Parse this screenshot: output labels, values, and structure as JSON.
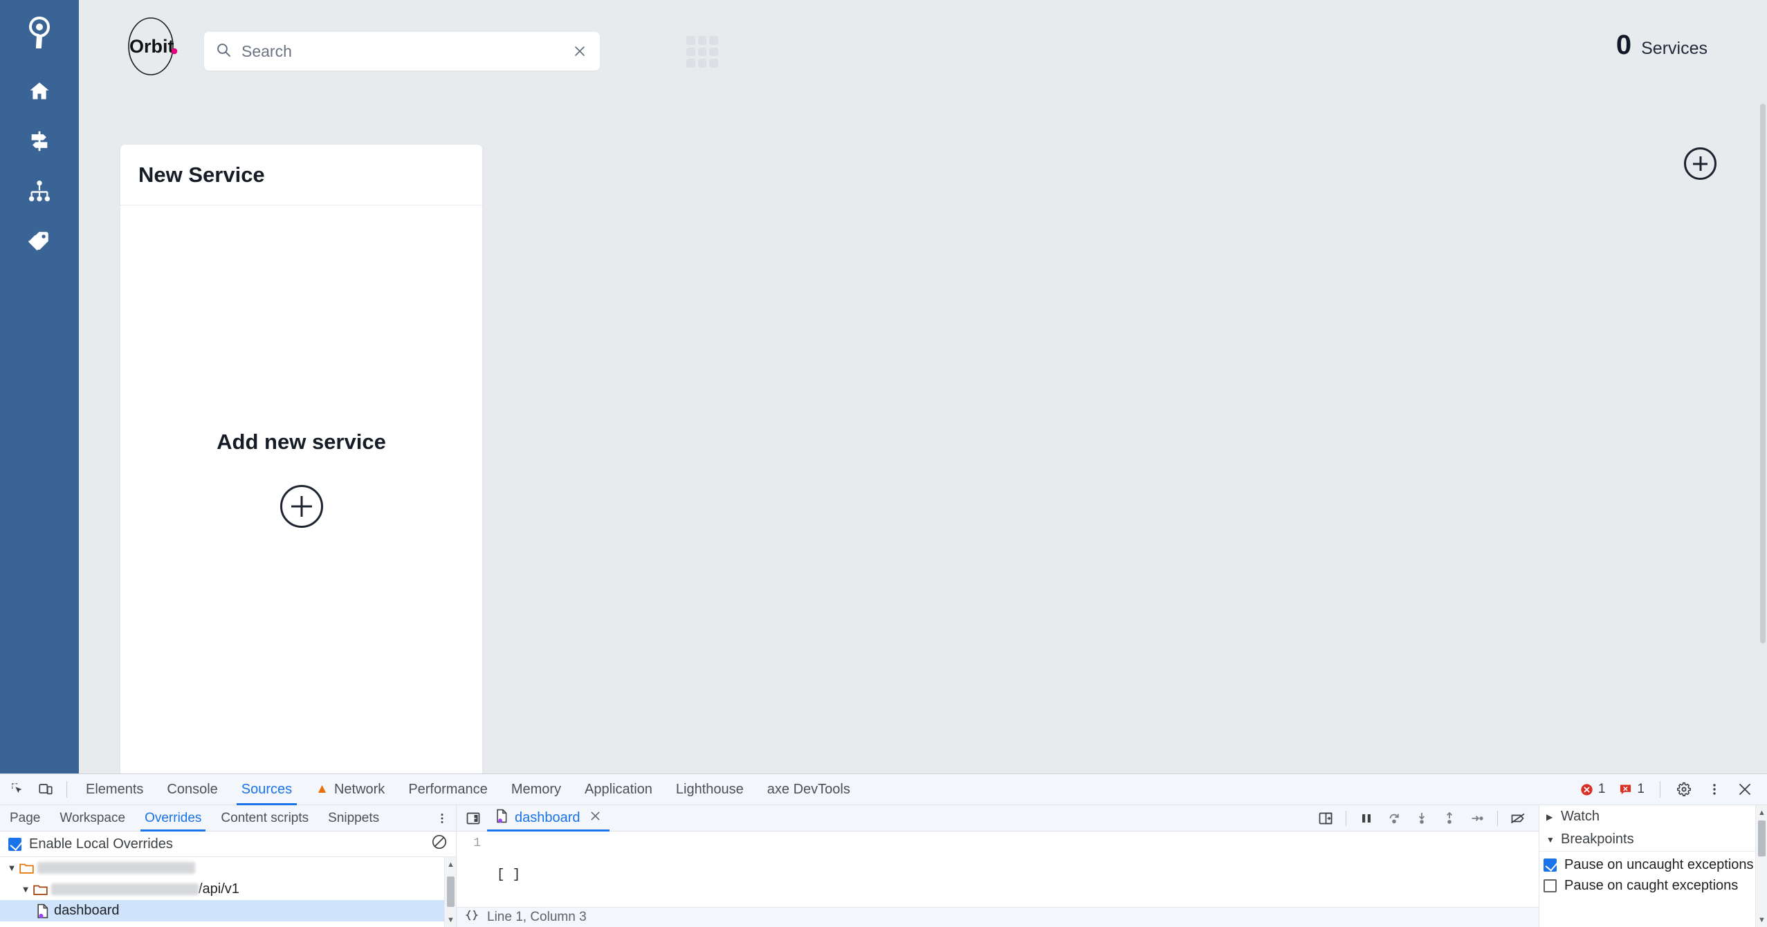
{
  "app": {
    "brand": {
      "name": "Orbit",
      "dot_color": "#e6007e"
    },
    "sidebar": {
      "logo_icon": "orbit-mark-icon",
      "items": [
        {
          "icon": "home-icon",
          "name": "home"
        },
        {
          "icon": "signpost-icon",
          "name": "directions"
        },
        {
          "icon": "sitemap-icon",
          "name": "hierarchy"
        },
        {
          "icon": "tags-icon",
          "name": "tags"
        }
      ]
    },
    "header": {
      "search": {
        "placeholder": "Search",
        "value": "",
        "icon": "search-icon",
        "clear_icon": "close-icon"
      },
      "grid_toggle_icon": "grid-view-icon",
      "services": {
        "count": "0",
        "label": "Services"
      }
    },
    "card": {
      "title": "New Service",
      "cta_text": "Add new service",
      "cta_icon": "plus-circle-icon"
    },
    "add_service_fab_icon": "plus-circle-icon",
    "accent_blue": "#396495"
  },
  "devtools": {
    "left_tools": [
      {
        "name": "inspect-element-icon"
      },
      {
        "name": "device-toolbar-icon"
      }
    ],
    "tabs": [
      {
        "label": "Elements",
        "active": false,
        "warn": false
      },
      {
        "label": "Console",
        "active": false,
        "warn": false
      },
      {
        "label": "Sources",
        "active": true,
        "warn": false
      },
      {
        "label": "Network",
        "active": false,
        "warn": true
      },
      {
        "label": "Performance",
        "active": false,
        "warn": false
      },
      {
        "label": "Memory",
        "active": false,
        "warn": false
      },
      {
        "label": "Application",
        "active": false,
        "warn": false
      },
      {
        "label": "Lighthouse",
        "active": false,
        "warn": false
      },
      {
        "label": "axe DevTools",
        "active": false,
        "warn": false
      }
    ],
    "status_counts": {
      "errors": "1",
      "messages": "1"
    },
    "right_tools": [
      {
        "name": "settings-gear-icon"
      },
      {
        "name": "more-options-icon"
      },
      {
        "name": "close-devtools-icon"
      }
    ],
    "sources": {
      "subtabs": [
        {
          "label": "Page",
          "active": false
        },
        {
          "label": "Workspace",
          "active": false
        },
        {
          "label": "Overrides",
          "active": true
        },
        {
          "label": "Content scripts",
          "active": false
        },
        {
          "label": "Snippets",
          "active": false
        }
      ],
      "more_icon": "more-options-icon",
      "overrides": {
        "checkbox_label": "Enable Local Overrides",
        "checkbox_checked": true,
        "clear_icon": "clear-configuration-icon"
      },
      "tree": [
        {
          "type": "folder",
          "label": "",
          "redacted": true,
          "redacted_width": 228,
          "suffix": "",
          "expanded": true,
          "indent": 0,
          "selected": false
        },
        {
          "type": "folder",
          "label": "",
          "redacted": true,
          "redacted_width": 213,
          "suffix": "/api/v1",
          "expanded": true,
          "indent": 1,
          "selected": false
        },
        {
          "type": "file",
          "label": "dashboard",
          "redacted": false,
          "indent": 2,
          "selected": true,
          "badge": "override-dot"
        }
      ]
    },
    "editor": {
      "navigator_toggle_icon": "show-navigator-icon",
      "tab": {
        "label": "dashboard",
        "file_icon": "json-file-icon",
        "badge": "override-dot",
        "close_icon": "close-icon"
      },
      "debug_controls": [
        {
          "name": "pause-script-execution-icon"
        },
        {
          "name": "step-over-icon"
        },
        {
          "name": "step-into-icon"
        },
        {
          "name": "step-out-icon"
        },
        {
          "name": "step-icon"
        },
        {
          "name": "deactivate-breakpoints-icon"
        }
      ],
      "lines": [
        {
          "num": "1",
          "text": "[ ]"
        }
      ],
      "status": {
        "pretty_print_icon": "format-braces-icon",
        "position": "Line 1, Column 3"
      }
    },
    "debugger": {
      "watch": {
        "label": "Watch",
        "expanded": false
      },
      "breakpoints": {
        "label": "Breakpoints",
        "expanded": true,
        "options": [
          {
            "label": "Pause on uncaught exceptions",
            "checked": true
          },
          {
            "label": "Pause on caught exceptions",
            "checked": false
          }
        ]
      }
    }
  }
}
